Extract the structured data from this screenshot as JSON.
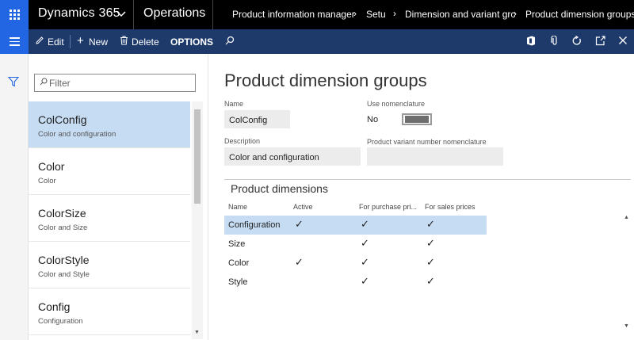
{
  "nav": {
    "product": "Dynamics 365",
    "module": "Operations",
    "breadcrumbs": [
      "Product information manager",
      "Setu",
      "Dimension and variant grc",
      "Product dimension groups"
    ]
  },
  "actions": {
    "edit": "Edit",
    "new": "New",
    "delete": "Delete",
    "options": "OPTIONS"
  },
  "filter": {
    "placeholder": "Filter"
  },
  "list": [
    {
      "title": "ColConfig",
      "subtitle": "Color and configuration",
      "selected": true
    },
    {
      "title": "Color",
      "subtitle": "Color"
    },
    {
      "title": "ColorSize",
      "subtitle": "Color and Size"
    },
    {
      "title": "ColorStyle",
      "subtitle": "Color and Style"
    },
    {
      "title": "Config",
      "subtitle": "Configuration"
    }
  ],
  "details": {
    "title": "Product dimension groups",
    "name_label": "Name",
    "name_value": "ColConfig",
    "description_label": "Description",
    "description_value": "Color and configuration",
    "use_nomenclature_label": "Use nomenclature",
    "use_nomenclature_value": "No",
    "variant_nomenclature_label": "Product variant number nomenclature",
    "variant_nomenclature_value": ""
  },
  "dimensions": {
    "title": "Product dimensions",
    "columns": [
      "Name",
      "Active",
      "For purchase pri...",
      "For sales prices"
    ],
    "rows": [
      {
        "name": "Configuration",
        "active": "✓",
        "purchase": "✓",
        "sales": "✓",
        "selected": true
      },
      {
        "name": "Size",
        "active": "",
        "purchase": "✓",
        "sales": "✓"
      },
      {
        "name": "Color",
        "active": "✓",
        "purchase": "✓",
        "sales": "✓"
      },
      {
        "name": "Style",
        "active": "",
        "purchase": "✓",
        "sales": "✓"
      }
    ]
  },
  "colors": {
    "accent": "#2266e3",
    "actionbar": "#1d3a6b",
    "selected": "#c6dcf3"
  }
}
